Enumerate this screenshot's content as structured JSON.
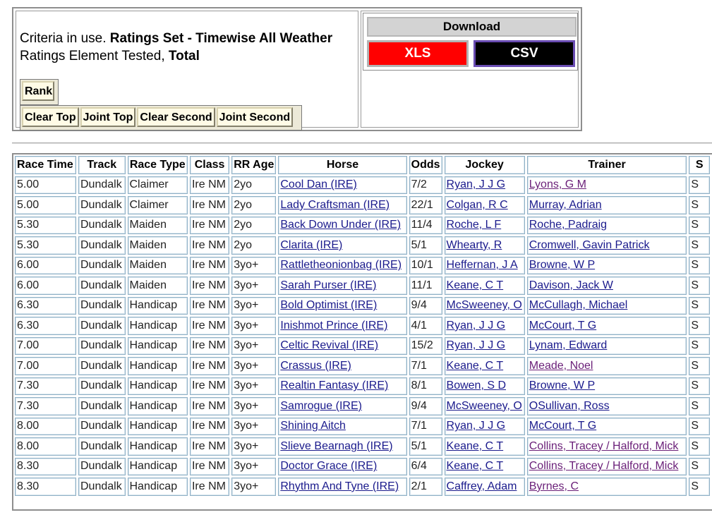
{
  "criteria": {
    "prefix": "Criteria in use.",
    "ratings_set": "Ratings Set - Timewise All Weather",
    "element_prefix": "Ratings Element Tested,",
    "element_value": "Total"
  },
  "buttons": {
    "rank": "Rank",
    "clear_top": "Clear Top",
    "joint_top": "Joint Top",
    "clear_second": "Clear Second",
    "joint_second": "Joint Second"
  },
  "download": {
    "title": "Download",
    "xls": "XLS",
    "csv": "CSV"
  },
  "colors": {
    "xls_bg": "#ff0000",
    "csv_bg": "#000000",
    "link": "#1a1a8c",
    "visited_link": "#6a1f78"
  },
  "table": {
    "headers": [
      "Race Time",
      "Track",
      "Race Type",
      "Class",
      "RR Age",
      "Horse",
      "Odds",
      "Jockey",
      "Trainer",
      "S"
    ],
    "rows": [
      {
        "time": "5.00",
        "track": "Dundalk",
        "type": "Claimer",
        "class": "Ire NM",
        "age": "2yo",
        "horse": "Cool Dan (IRE)",
        "odds": "7/2",
        "jockey": "Ryan, J J G",
        "trainer": "Lyons, G M",
        "trainer_visited": true,
        "extra": "S"
      },
      {
        "time": "5.00",
        "track": "Dundalk",
        "type": "Claimer",
        "class": "Ire NM",
        "age": "2yo",
        "horse": "Lady Craftsman (IRE)",
        "odds": "22/1",
        "jockey": "Colgan, R C",
        "trainer": "Murray, Adrian",
        "trainer_visited": false,
        "extra": "S"
      },
      {
        "time": "5.30",
        "track": "Dundalk",
        "type": "Maiden",
        "class": "Ire NM",
        "age": "2yo",
        "horse": "Back Down Under (IRE)",
        "odds": "11/4",
        "jockey": "Roche, L F",
        "trainer": "Roche, Padraig",
        "trainer_visited": false,
        "extra": "S"
      },
      {
        "time": "5.30",
        "track": "Dundalk",
        "type": "Maiden",
        "class": "Ire NM",
        "age": "2yo",
        "horse": "Clarita (IRE)",
        "odds": "5/1",
        "jockey": "Whearty, R",
        "trainer": "Cromwell, Gavin Patrick",
        "trainer_visited": false,
        "extra": "S"
      },
      {
        "time": "6.00",
        "track": "Dundalk",
        "type": "Maiden",
        "class": "Ire NM",
        "age": "3yo+",
        "horse": "Rattletheonionbag (IRE)",
        "odds": "10/1",
        "jockey": "Heffernan, J A",
        "trainer": "Browne, W P",
        "trainer_visited": false,
        "extra": "S"
      },
      {
        "time": "6.00",
        "track": "Dundalk",
        "type": "Maiden",
        "class": "Ire NM",
        "age": "3yo+",
        "horse": "Sarah Purser (IRE)",
        "odds": "11/1",
        "jockey": "Keane, C T",
        "trainer": "Davison, Jack W",
        "trainer_visited": false,
        "extra": "S"
      },
      {
        "time": "6.30",
        "track": "Dundalk",
        "type": "Handicap",
        "class": "Ire NM",
        "age": "3yo+",
        "horse": "Bold Optimist (IRE)",
        "odds": "9/4",
        "jockey": "McSweeney, O",
        "trainer": "McCullagh, Michael",
        "trainer_visited": false,
        "extra": "S"
      },
      {
        "time": "6.30",
        "track": "Dundalk",
        "type": "Handicap",
        "class": "Ire NM",
        "age": "3yo+",
        "horse": "Inishmot Prince (IRE)",
        "odds": "4/1",
        "jockey": "Ryan, J J G",
        "trainer": "McCourt, T G",
        "trainer_visited": false,
        "extra": "S"
      },
      {
        "time": "7.00",
        "track": "Dundalk",
        "type": "Handicap",
        "class": "Ire NM",
        "age": "3yo+",
        "horse": "Celtic Revival (IRE)",
        "odds": "15/2",
        "jockey": "Ryan, J J G",
        "trainer": "Lynam, Edward",
        "trainer_visited": false,
        "extra": "S"
      },
      {
        "time": "7.00",
        "track": "Dundalk",
        "type": "Handicap",
        "class": "Ire NM",
        "age": "3yo+",
        "horse": "Crassus (IRE)",
        "odds": "7/1",
        "jockey": "Keane, C T",
        "trainer": "Meade, Noel",
        "trainer_visited": true,
        "extra": "S"
      },
      {
        "time": "7.30",
        "track": "Dundalk",
        "type": "Handicap",
        "class": "Ire NM",
        "age": "3yo+",
        "horse": "Realtin Fantasy (IRE)",
        "odds": "8/1",
        "jockey": "Bowen, S D",
        "trainer": "Browne, W P",
        "trainer_visited": false,
        "extra": "S"
      },
      {
        "time": "7.30",
        "track": "Dundalk",
        "type": "Handicap",
        "class": "Ire NM",
        "age": "3yo+",
        "horse": "Samrogue (IRE)",
        "odds": "9/4",
        "jockey": "McSweeney, O",
        "trainer": "OSullivan, Ross",
        "trainer_visited": false,
        "extra": "S"
      },
      {
        "time": "8.00",
        "track": "Dundalk",
        "type": "Handicap",
        "class": "Ire NM",
        "age": "3yo+",
        "horse": "Shining Aitch",
        "odds": "7/1",
        "jockey": "Ryan, J J G",
        "trainer": "McCourt, T G",
        "trainer_visited": false,
        "extra": "S"
      },
      {
        "time": "8.00",
        "track": "Dundalk",
        "type": "Handicap",
        "class": "Ire NM",
        "age": "3yo+",
        "horse": "Slieve Bearnagh (IRE)",
        "odds": "5/1",
        "jockey": "Keane, C T",
        "trainer": "Collins, Tracey / Halford, Mick",
        "trainer_visited": true,
        "extra": "S"
      },
      {
        "time": "8.30",
        "track": "Dundalk",
        "type": "Handicap",
        "class": "Ire NM",
        "age": "3yo+",
        "horse": "Doctor Grace (IRE)",
        "odds": "6/4",
        "jockey": "Keane, C T",
        "trainer": "Collins, Tracey / Halford, Mick",
        "trainer_visited": true,
        "extra": "S"
      },
      {
        "time": "8.30",
        "track": "Dundalk",
        "type": "Handicap",
        "class": "Ire NM",
        "age": "3yo+",
        "horse": "Rhythm And Tyne (IRE)",
        "odds": "2/1",
        "jockey": "Caffrey, Adam",
        "trainer": "Byrnes, C",
        "trainer_visited": true,
        "extra": "S"
      }
    ]
  }
}
